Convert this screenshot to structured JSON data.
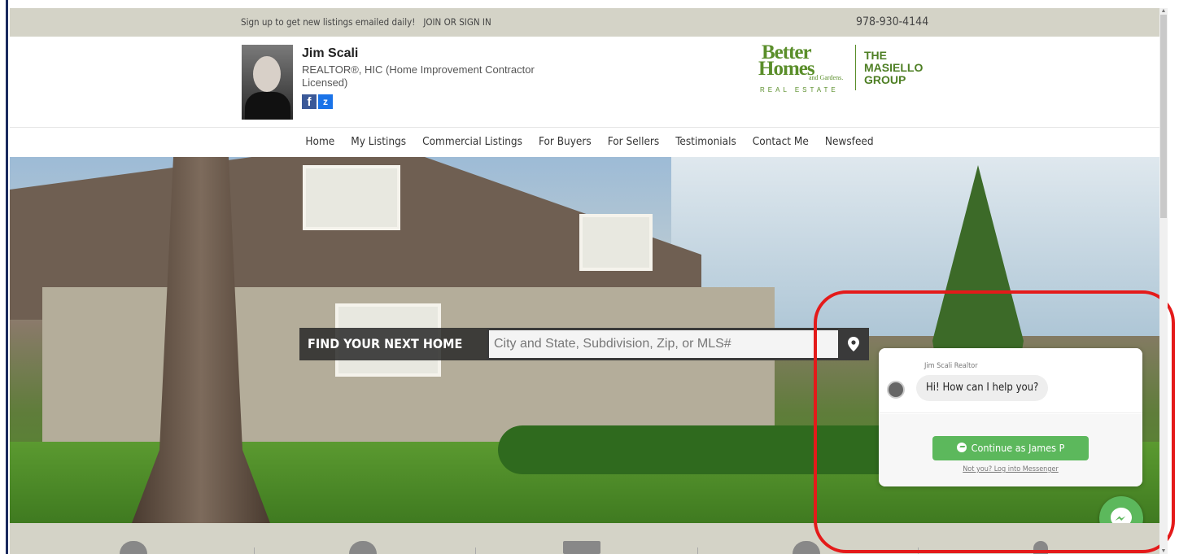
{
  "topbar": {
    "signup_text": "Sign up to get new listings emailed daily!",
    "join_label": "JOIN",
    "or_label": "OR",
    "signin_label": "SIGN IN",
    "phone": "978-930-4144"
  },
  "agent": {
    "name": "Jim Scali",
    "title": "REALTOR®, HIC (Home Improvement Contractor Licensed)",
    "social": [
      "facebook-icon",
      "zillow-icon"
    ]
  },
  "brokerage": {
    "line1": "Better",
    "line2": "Homes",
    "line3": "and Gardens.",
    "line4": "REAL ESTATE",
    "group_lines": [
      "THE",
      "MASIELLO",
      "GROUP"
    ]
  },
  "nav": {
    "items": [
      {
        "label": "Home"
      },
      {
        "label": "My Listings"
      },
      {
        "label": "Commercial Listings"
      },
      {
        "label": "For Buyers"
      },
      {
        "label": "For Sellers"
      },
      {
        "label": "Testimonials"
      },
      {
        "label": "Contact Me"
      },
      {
        "label": "Newsfeed"
      }
    ]
  },
  "search": {
    "label": "FIND YOUR NEXT HOME",
    "placeholder": "City and State, Subdivision, Zip, or MLS#",
    "icon": "map-pin-icon"
  },
  "chat": {
    "sender": "Jim Scali Realtor",
    "message": "Hi! How can I help you?",
    "continue_label": "Continue as James P",
    "not_you_label": "Not you? Log into Messenger"
  },
  "colors": {
    "topbar_bg": "#d4d3c7",
    "brand_green": "#5a8e2a",
    "chat_green": "#5cb85c",
    "highlight_red": "#e41a1a"
  }
}
